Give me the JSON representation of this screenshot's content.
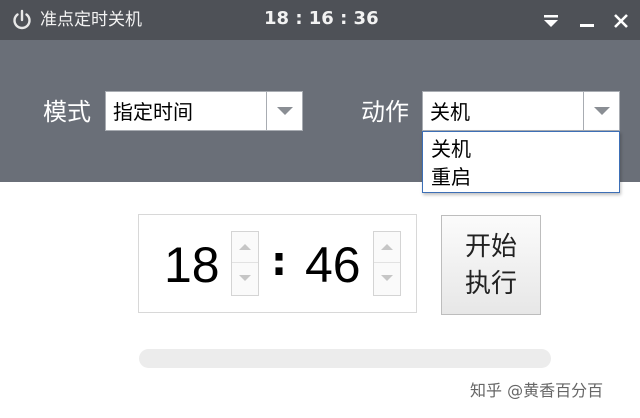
{
  "window": {
    "title": "准点定时关机",
    "clock": "18 : 16 : 36",
    "buttons": [
      "menu-icon",
      "minimize-icon",
      "close-icon"
    ]
  },
  "controls": {
    "mode_label": "模式",
    "mode_value": "指定时间",
    "action_label": "动作",
    "action_value": "关机",
    "action_options": [
      "关机",
      "重启"
    ]
  },
  "time": {
    "hour": "18",
    "separator": ":",
    "minute": "46"
  },
  "start_button": {
    "line1": "开始",
    "line2": "执行"
  },
  "progress": {
    "value": 0
  },
  "watermark": "知乎 @黄香百分百",
  "colors": {
    "titlebar": "#4e5157",
    "band": "#6a6f78",
    "dropdown_border": "#3d6fb6"
  }
}
